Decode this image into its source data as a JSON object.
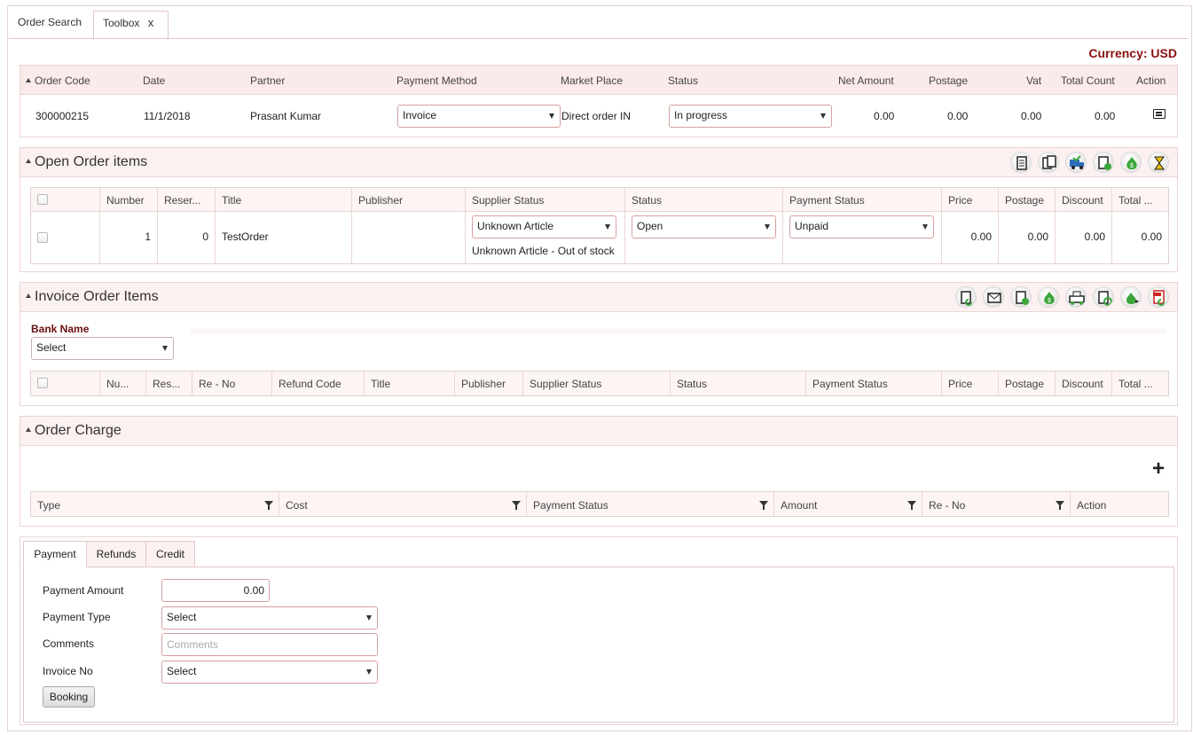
{
  "tabs": [
    {
      "label": "Order Search"
    },
    {
      "label": "Toolbox",
      "close": "x"
    }
  ],
  "currency": "Currency: USD",
  "order": {
    "headers": [
      "Order Code",
      "Date",
      "Partner",
      "Payment Method",
      "Market Place",
      "Status",
      "Net Amount",
      "Postage",
      "Vat",
      "Total Count",
      "Action"
    ],
    "row": {
      "code": "300000215",
      "date": "11/1/2018",
      "partner": "Prasant Kumar",
      "payment_method": "Invoice",
      "market_place": "Direct order IN",
      "status": "In progress",
      "net_amount": "0.00",
      "postage": "0.00",
      "vat": "0.00",
      "total_count": "0.00"
    }
  },
  "open_items": {
    "title": "Open Order items",
    "toolbar_icons": [
      "document-icon",
      "invoice-icon",
      "truck-icon",
      "receipt-icon",
      "money-bag-icon",
      "hourglass-icon"
    ],
    "headers": [
      "Number",
      "Reser...",
      "Title",
      "Publisher",
      "Supplier Status",
      "Status",
      "Payment Status",
      "Price",
      "Postage",
      "Discount",
      "Total ..."
    ],
    "row": {
      "number": "1",
      "reserved": "0",
      "title": "TestOrder",
      "publisher": "",
      "supplier_status": "Unknown Article",
      "supplier_note": "Unknown Article - Out of stock",
      "status": "Open",
      "payment_status": "Unpaid",
      "price": "0.00",
      "postage": "0.00",
      "discount": "0.00",
      "total": "0.00"
    }
  },
  "invoice_items": {
    "title": "Invoice Order Items",
    "toolbar_icons": [
      "refund-doc-icon",
      "mail-icon",
      "approve-doc-icon",
      "money-bag-icon",
      "cash-register-icon",
      "refresh-doc-icon",
      "money-return-icon",
      "pdf-return-icon"
    ],
    "bank_label": "Bank Name",
    "bank_value": "Select",
    "headers": [
      "Nu...",
      "Res...",
      "Re - No",
      "Refund Code",
      "Title",
      "Publisher",
      "Supplier Status",
      "Status",
      "Payment Status",
      "Price",
      "Postage",
      "Discount",
      "Total ..."
    ]
  },
  "order_charge": {
    "title": "Order Charge",
    "add": "+",
    "headers": [
      "Type",
      "Cost",
      "Payment Status",
      "Amount",
      "Re - No",
      "Action"
    ]
  },
  "payment": {
    "tabs": [
      "Payment",
      "Refunds",
      "Credit"
    ],
    "amount_label": "Payment Amount",
    "amount_value": "0.00",
    "type_label": "Payment Type",
    "type_value": "Select",
    "comments_label": "Comments",
    "comments_placeholder": "Comments",
    "invoice_label": "Invoice No",
    "invoice_value": "Select",
    "booking": "Booking"
  }
}
